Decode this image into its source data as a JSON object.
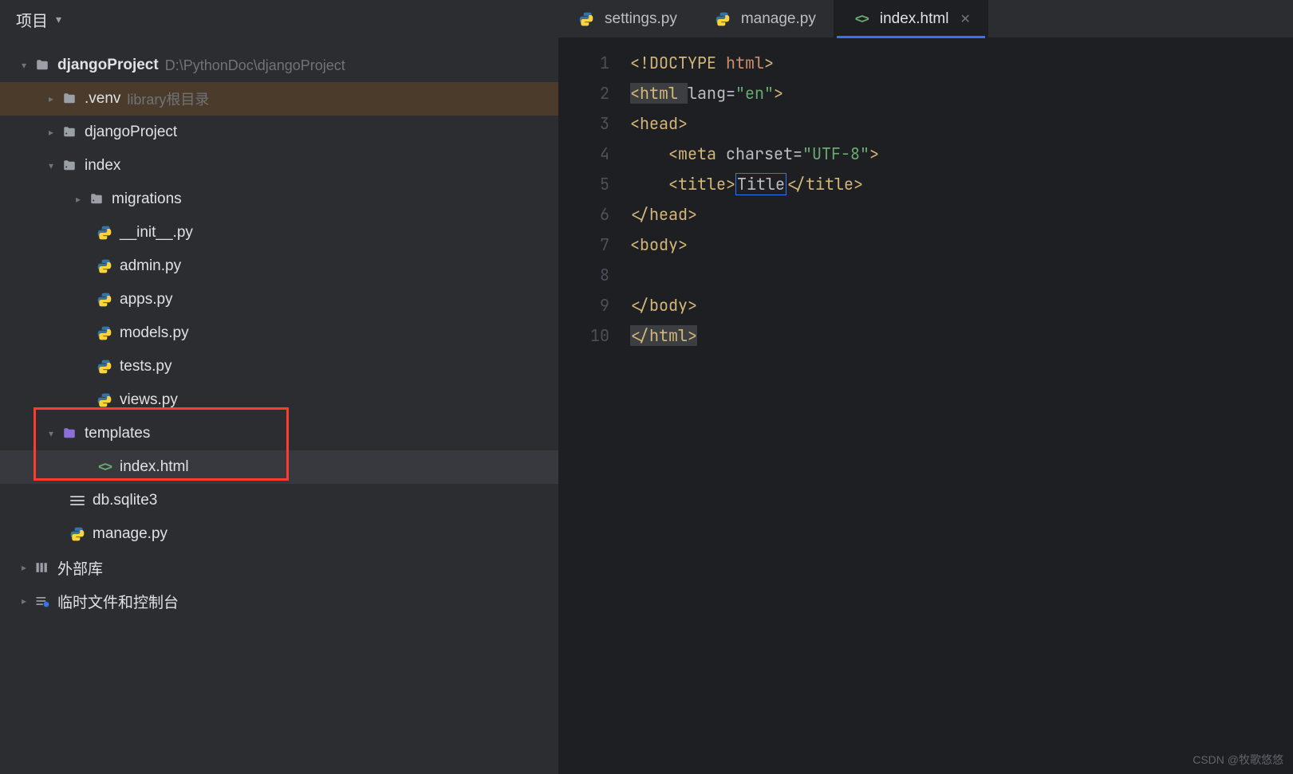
{
  "sidebar": {
    "title": "项目",
    "project": {
      "name": "djangoProject",
      "path": "D:\\PythonDoc\\djangoProject"
    },
    "tree": {
      "venv": ".venv",
      "venv_note": "library根目录",
      "djangoProject": "djangoProject",
      "index": "index",
      "migrations": "migrations",
      "init": "__init__.py",
      "admin": "admin.py",
      "apps": "apps.py",
      "models": "models.py",
      "tests": "tests.py",
      "views": "views.py",
      "templates": "templates",
      "index_html": "index.html",
      "db": "db.sqlite3",
      "manage": "manage.py",
      "external": "外部库",
      "scratch": "临时文件和控制台"
    }
  },
  "tabs": [
    {
      "label": "settings.py",
      "type": "python",
      "active": false
    },
    {
      "label": "manage.py",
      "type": "python",
      "active": false
    },
    {
      "label": "index.html",
      "type": "html",
      "active": true
    }
  ],
  "editor": {
    "line_count": 10,
    "code": {
      "l1_a": "<!DOCTYPE ",
      "l1_b": "html",
      "l1_c": ">",
      "l2_a": "<html ",
      "l2_b": "lang",
      "l2_c": "=",
      "l2_d": "\"en\"",
      "l2_e": ">",
      "l3": "<head>",
      "l4_a": "    <meta ",
      "l4_b": "charset",
      "l4_c": "=",
      "l4_d": "\"UTF-8\"",
      "l4_e": ">",
      "l5_a": "    <title>",
      "l5_b": "Title",
      "l5_c": "</title>",
      "l6": "</head>",
      "l7": "<body>",
      "l8": "",
      "l9": "</body>",
      "l10": "</html>"
    }
  },
  "watermark": "CSDN @牧歌悠悠"
}
